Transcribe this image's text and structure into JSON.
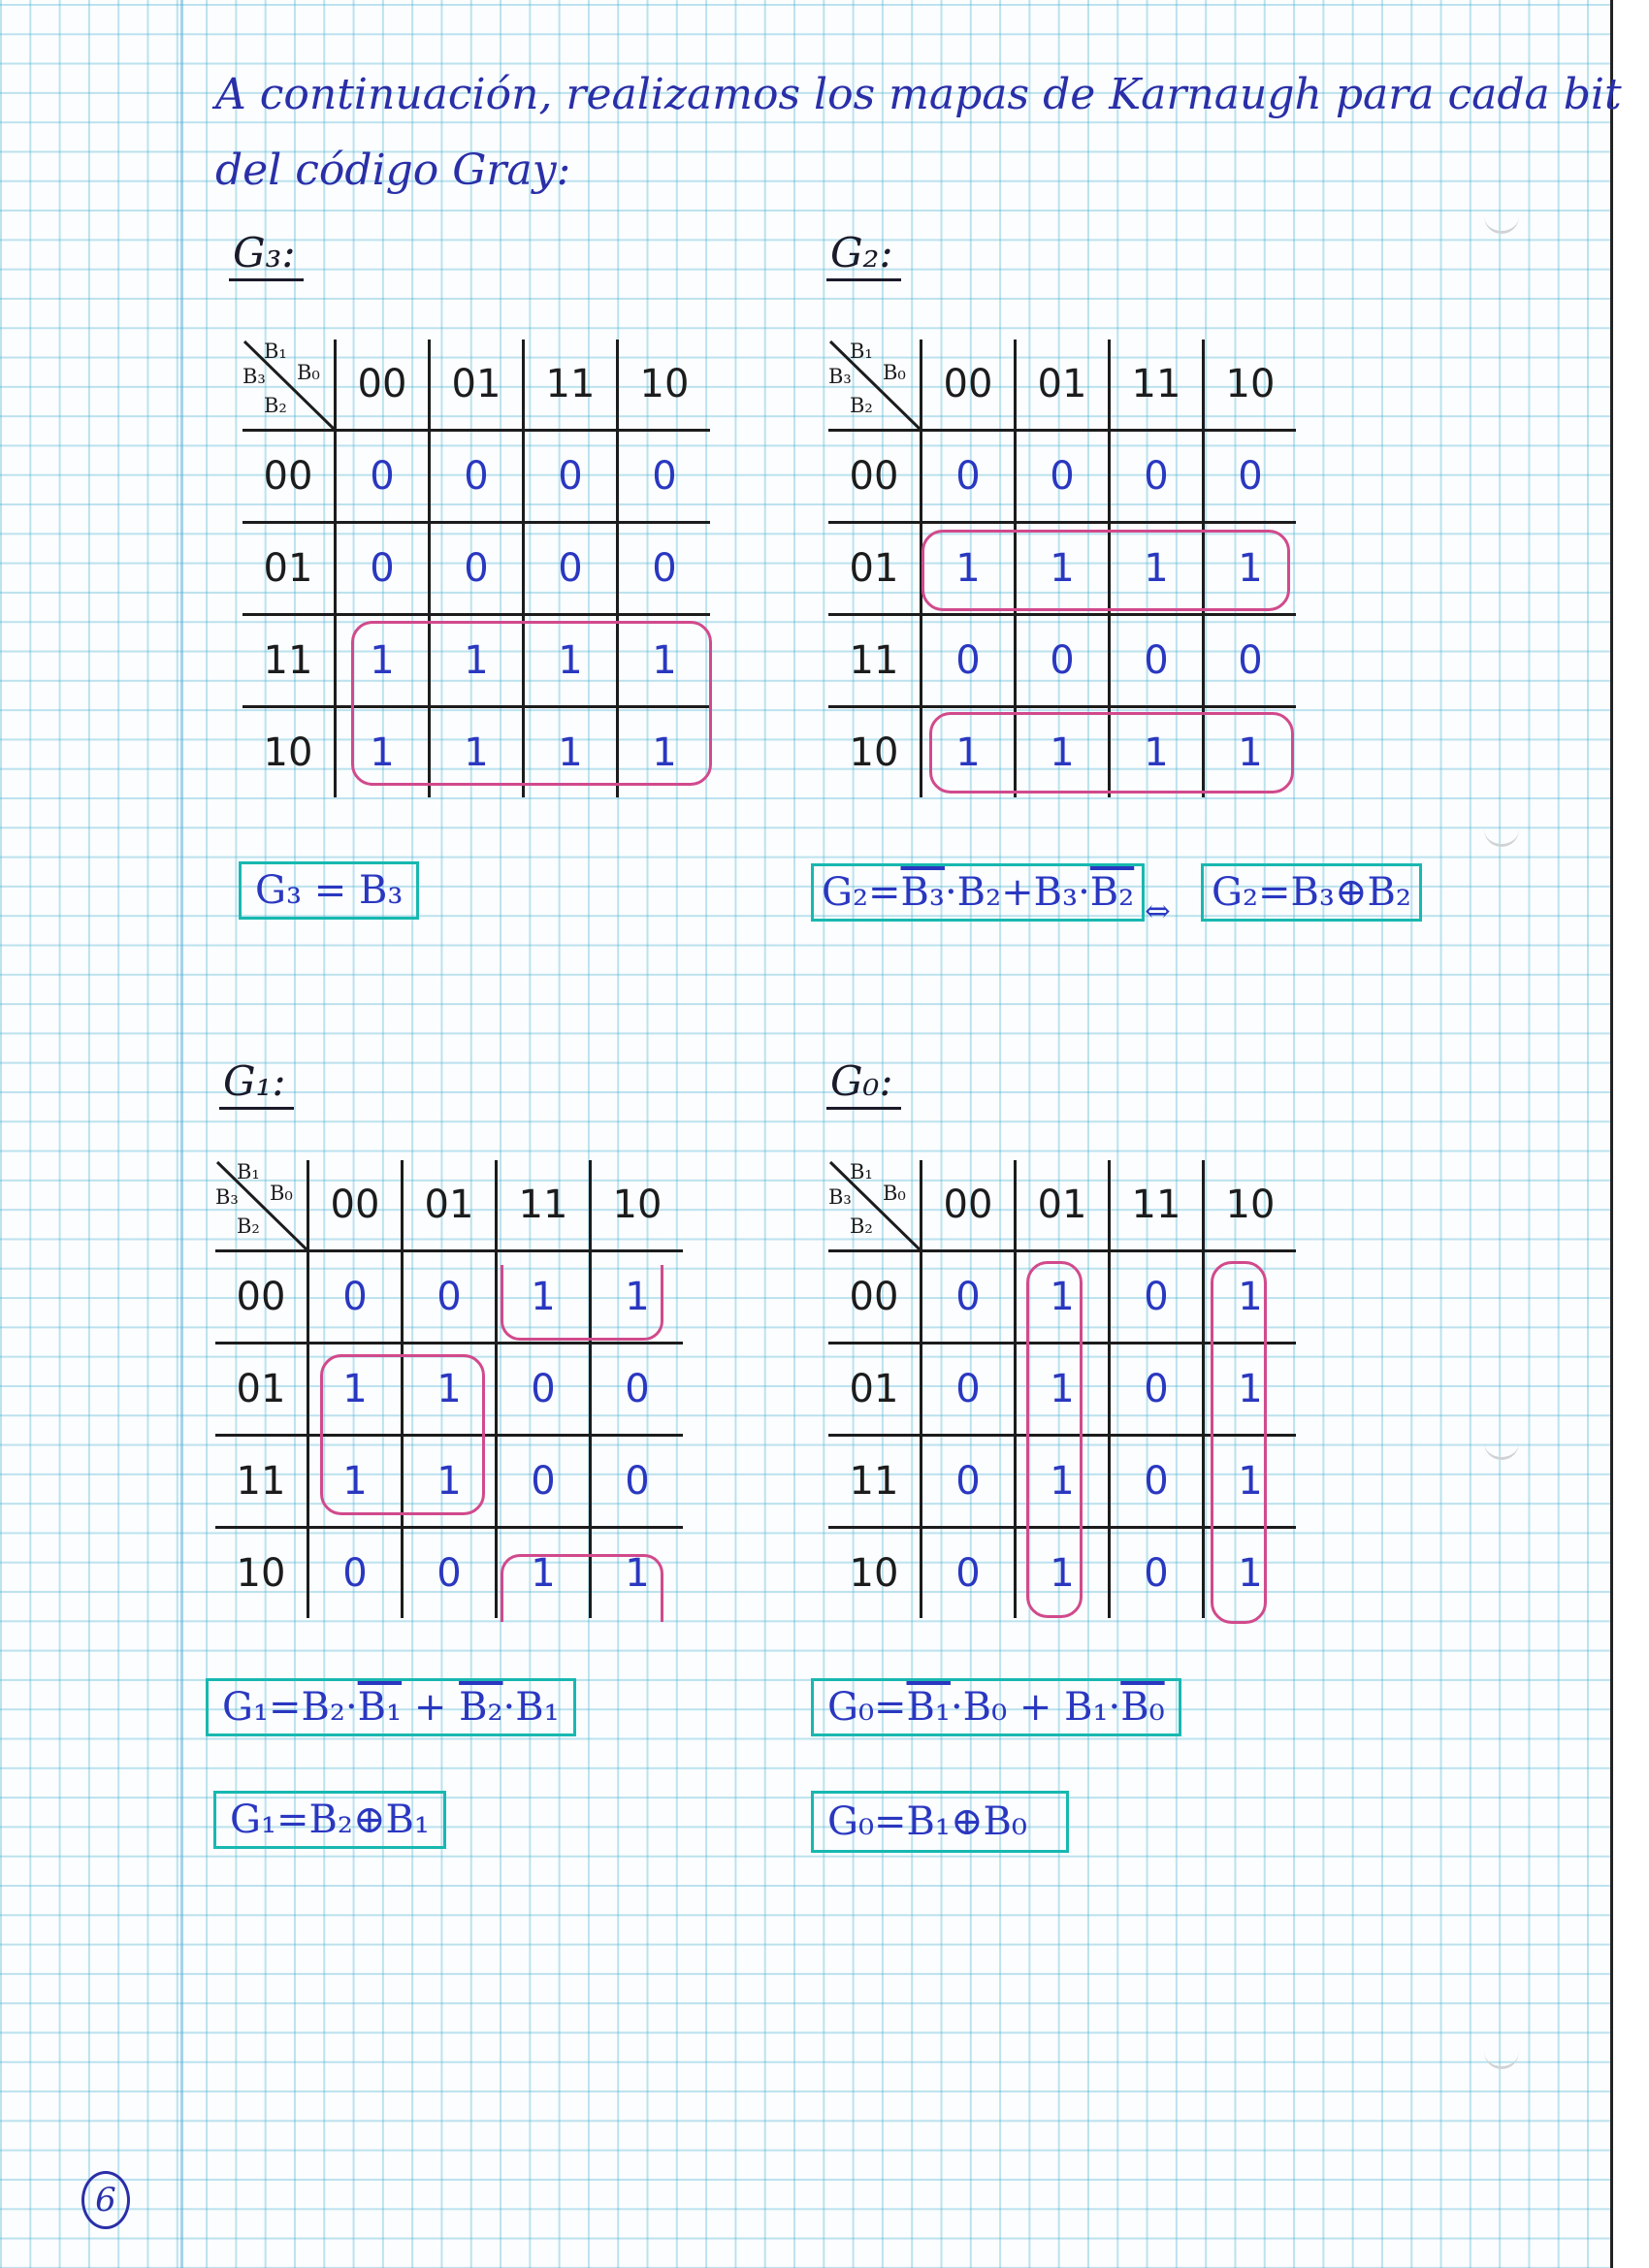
{
  "intro": {
    "line1": "A continuación, realizamos los mapas de Karnaugh para cada bit",
    "line2": "del código Gray:"
  },
  "colors": {
    "ink_blue": "#2a37c0",
    "ink_black": "#1c1c1c",
    "group_pink": "#d14a8c",
    "box_teal": "#18b8b0"
  },
  "maps": {
    "g3": {
      "title": "G₃:",
      "labels": {
        "top_a": "B₁",
        "top_b": "B₀",
        "left_a": "B₃",
        "left_b": "B₂"
      },
      "cols": [
        "00",
        "01",
        "11",
        "10"
      ],
      "rows": [
        {
          "h": "00",
          "c": [
            "0",
            "0",
            "0",
            "0"
          ]
        },
        {
          "h": "01",
          "c": [
            "0",
            "0",
            "0",
            "0"
          ]
        },
        {
          "h": "11",
          "c": [
            "1",
            "1",
            "1",
            "1"
          ]
        },
        {
          "h": "10",
          "c": [
            "1",
            "1",
            "1",
            "1"
          ]
        }
      ],
      "result": {
        "lhs": "G₃",
        "eq": "=",
        "rhs": "B₃"
      }
    },
    "g2": {
      "title": "G₂:",
      "labels": {
        "top_a": "B₁",
        "top_b": "B₀",
        "left_a": "B₃",
        "left_b": "B₂"
      },
      "cols": [
        "00",
        "01",
        "11",
        "10"
      ],
      "rows": [
        {
          "h": "00",
          "c": [
            "0",
            "0",
            "0",
            "0"
          ]
        },
        {
          "h": "01",
          "c": [
            "1",
            "1",
            "1",
            "1"
          ]
        },
        {
          "h": "11",
          "c": [
            "0",
            "0",
            "0",
            "0"
          ]
        },
        {
          "h": "10",
          "c": [
            "1",
            "1",
            "1",
            "1"
          ]
        }
      ],
      "result": {
        "lhs": "G₂",
        "eq": "=",
        "t1a": "B₃",
        "dot1": "·",
        "t1b": "B₂",
        "plus": "+",
        "t2a": "B₃",
        "dot2": "·",
        "t2b": "B₂",
        "arrow": "⇔",
        "alt_lhs": "G₂",
        "alt_eq": "=",
        "alt_a": "B₃",
        "alt_op": "⊕",
        "alt_b": "B₂"
      }
    },
    "g1": {
      "title": "G₁:",
      "labels": {
        "top_a": "B₁",
        "top_b": "B₀",
        "left_a": "B₃",
        "left_b": "B₂"
      },
      "cols": [
        "00",
        "01",
        "11",
        "10"
      ],
      "rows": [
        {
          "h": "00",
          "c": [
            "0",
            "0",
            "1",
            "1"
          ]
        },
        {
          "h": "01",
          "c": [
            "1",
            "1",
            "0",
            "0"
          ]
        },
        {
          "h": "11",
          "c": [
            "1",
            "1",
            "0",
            "0"
          ]
        },
        {
          "h": "10",
          "c": [
            "0",
            "0",
            "1",
            "1"
          ]
        }
      ],
      "result": {
        "lhs": "G₁",
        "eq": "=",
        "t1a": "B₂",
        "dot1": "·",
        "t1b": "B₁",
        "plus": "+",
        "t2a": "B₂",
        "dot2": "·",
        "t2b": "B₁"
      },
      "result2": {
        "lhs": "G₁",
        "eq": "=",
        "a": "B₂",
        "op": "⊕",
        "b": "B₁"
      }
    },
    "g0": {
      "title": "G₀:",
      "labels": {
        "top_a": "B₁",
        "top_b": "B₀",
        "left_a": "B₃",
        "left_b": "B₂"
      },
      "cols": [
        "00",
        "01",
        "11",
        "10"
      ],
      "rows": [
        {
          "h": "00",
          "c": [
            "0",
            "1",
            "0",
            "1"
          ]
        },
        {
          "h": "01",
          "c": [
            "0",
            "1",
            "0",
            "1"
          ]
        },
        {
          "h": "11",
          "c": [
            "0",
            "1",
            "0",
            "1"
          ]
        },
        {
          "h": "10",
          "c": [
            "0",
            "1",
            "0",
            "1"
          ]
        }
      ],
      "result": {
        "lhs": "G₀",
        "eq": "=",
        "t1a": "B₁",
        "dot1": "·",
        "t1b": "B₀",
        "plus": "+",
        "t2a": "B₁",
        "dot2": "·",
        "t2b": "B₀"
      },
      "result2": {
        "lhs": "G₀",
        "eq": "=",
        "a": "B₁",
        "op": "⊕",
        "b": "B₀"
      }
    }
  },
  "page_number": "6"
}
